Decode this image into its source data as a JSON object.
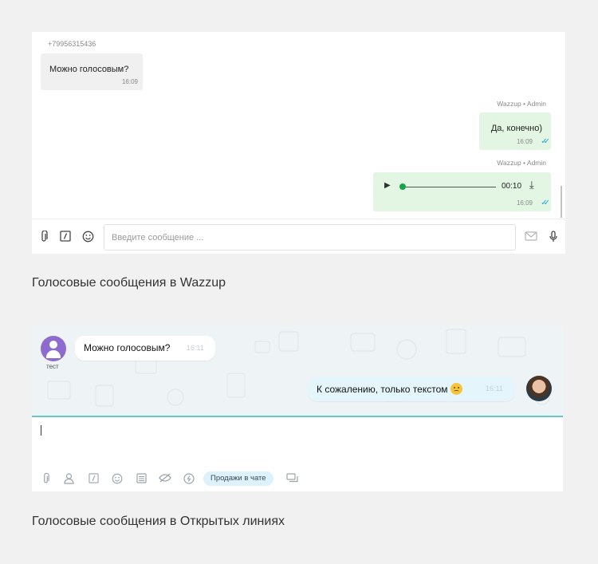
{
  "wazzup": {
    "incoming": {
      "sender": "+79956315436",
      "text": "Можно голосовым?",
      "time": "16:09"
    },
    "outgoing_text": {
      "meta": "Wazzup • Admin",
      "text": "Да, конечно)",
      "time": "16:09"
    },
    "outgoing_voice": {
      "meta": "Wazzup • Admin",
      "duration": "00:10",
      "time": "16:09",
      "progress": 0
    },
    "composer": {
      "placeholder": "Введите сообщение ..."
    },
    "caption": "Голосовые сообщения в Wazzup"
  },
  "openlines": {
    "incoming": {
      "avatar_label": "тест",
      "text": "Можно голосовым?",
      "time": "16:11"
    },
    "outgoing": {
      "text": "К сожалению, только текстом",
      "time": "16:11"
    },
    "toolbar": {
      "sales_pill": "Продажи в чате"
    },
    "caption": "Голосовые сообщения в Открытых линиях"
  },
  "colors": {
    "page_bg": "#f1f1f1",
    "wazzup_out_bubble": "#e3f6e4",
    "wazzup_accent": "#16a34a",
    "read_ticks": "#23a6d5",
    "openlines_chat_bg": "#eef3f6",
    "openlines_divider": "#69c7c9",
    "openlines_out_bubble": "#e4f6fc",
    "avatar_purple": "#8e6bcf"
  },
  "icons": [
    "paperclip-icon",
    "slash-command-icon",
    "smiley-icon",
    "send-icon",
    "microphone-icon",
    "play-icon",
    "download-icon",
    "double-check-icon",
    "user-icon",
    "list-icon",
    "hidden-icon",
    "coin-icon",
    "window-icon"
  ]
}
